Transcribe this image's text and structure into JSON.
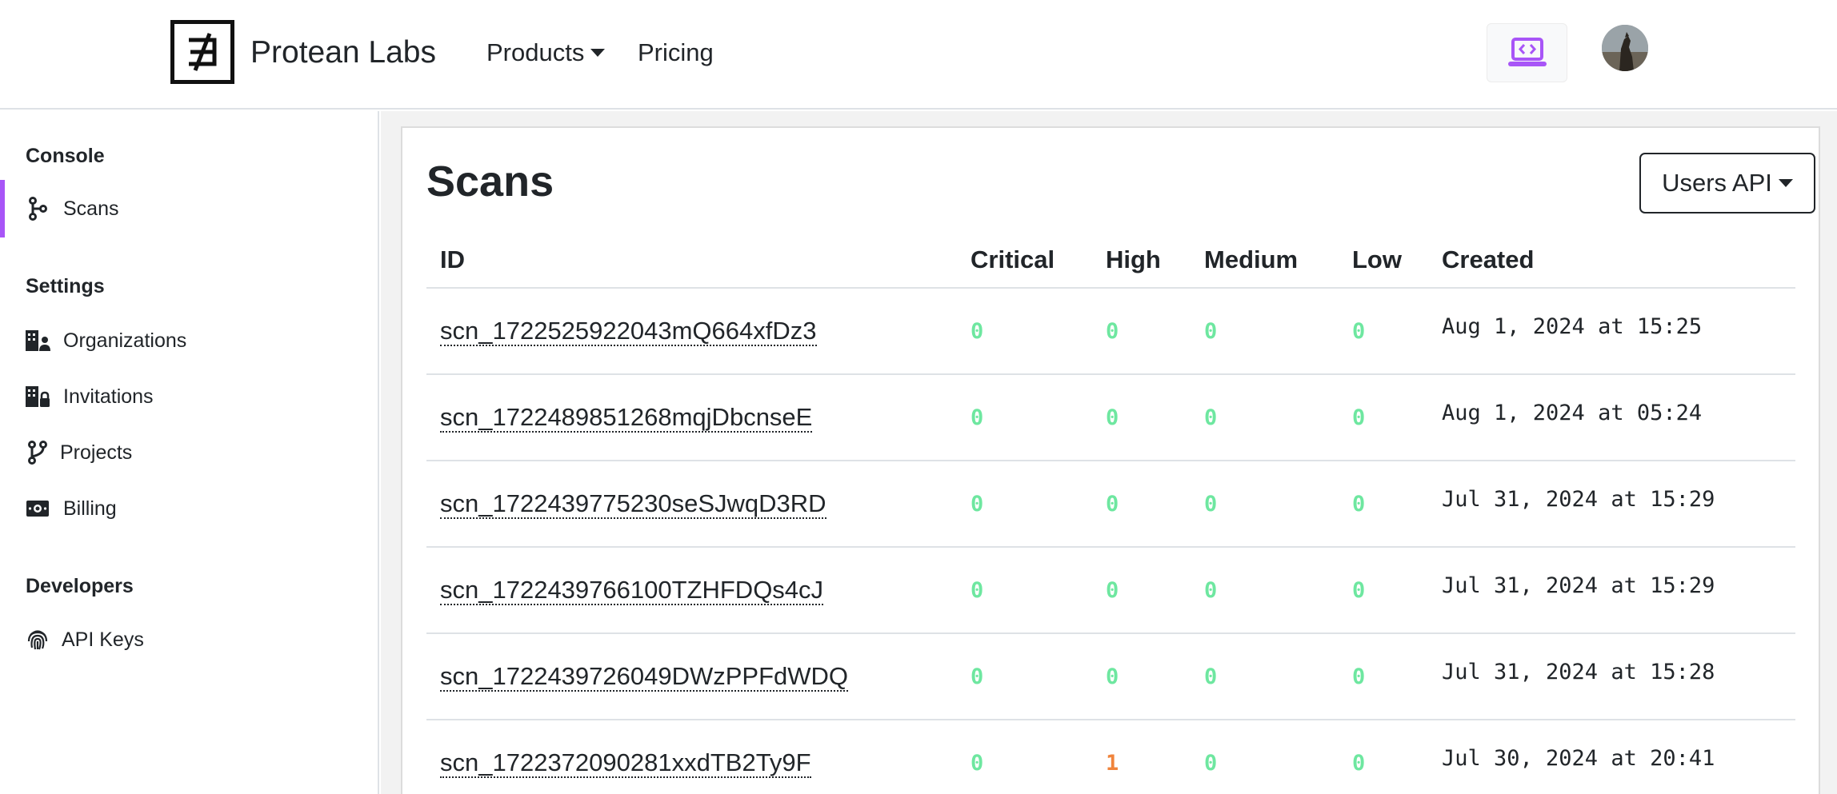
{
  "brand": {
    "name": "Protean Labs"
  },
  "nav": {
    "products": "Products",
    "pricing": "Pricing"
  },
  "sidebar": {
    "sections": [
      {
        "title": "Console",
        "items": [
          {
            "label": "Scans",
            "icon": "git-branch-icon",
            "active": true
          }
        ]
      },
      {
        "title": "Settings",
        "items": [
          {
            "label": "Organizations",
            "icon": "building-user-icon"
          },
          {
            "label": "Invitations",
            "icon": "building-lock-icon"
          },
          {
            "label": "Projects",
            "icon": "git-fork-icon"
          },
          {
            "label": "Billing",
            "icon": "cash-icon"
          }
        ]
      },
      {
        "title": "Developers",
        "items": [
          {
            "label": "API Keys",
            "icon": "fingerprint-icon"
          }
        ]
      }
    ]
  },
  "main": {
    "title": "Scans",
    "project_selector": "Users API",
    "columns": [
      "ID",
      "Critical",
      "High",
      "Medium",
      "Low",
      "Created"
    ],
    "rows": [
      {
        "id": "scn_1722525922043mQ664xfDz3",
        "critical": 0,
        "high": 0,
        "medium": 0,
        "low": 0,
        "created": "Aug 1, 2024 at 15:25"
      },
      {
        "id": "scn_1722489851268mqjDbcnseE",
        "critical": 0,
        "high": 0,
        "medium": 0,
        "low": 0,
        "created": "Aug 1, 2024 at 05:24"
      },
      {
        "id": "scn_1722439775230seSJwqD3RD",
        "critical": 0,
        "high": 0,
        "medium": 0,
        "low": 0,
        "created": "Jul 31, 2024 at 15:29"
      },
      {
        "id": "scn_1722439766100TZHFDQs4cJ",
        "critical": 0,
        "high": 0,
        "medium": 0,
        "low": 0,
        "created": "Jul 31, 2024 at 15:29"
      },
      {
        "id": "scn_1722439726049DWzPPFdWDQ",
        "critical": 0,
        "high": 0,
        "medium": 0,
        "low": 0,
        "created": "Jul 31, 2024 at 15:28"
      },
      {
        "id": "scn_1722372090281xxdTB2Ty9F",
        "critical": 0,
        "high": 1,
        "medium": 0,
        "low": 0,
        "created": "Jul 30, 2024 at 20:41"
      }
    ]
  },
  "colors": {
    "accent": "#a855f7",
    "zero_count": "#6ee7a0",
    "high_count": "#f0843c"
  }
}
